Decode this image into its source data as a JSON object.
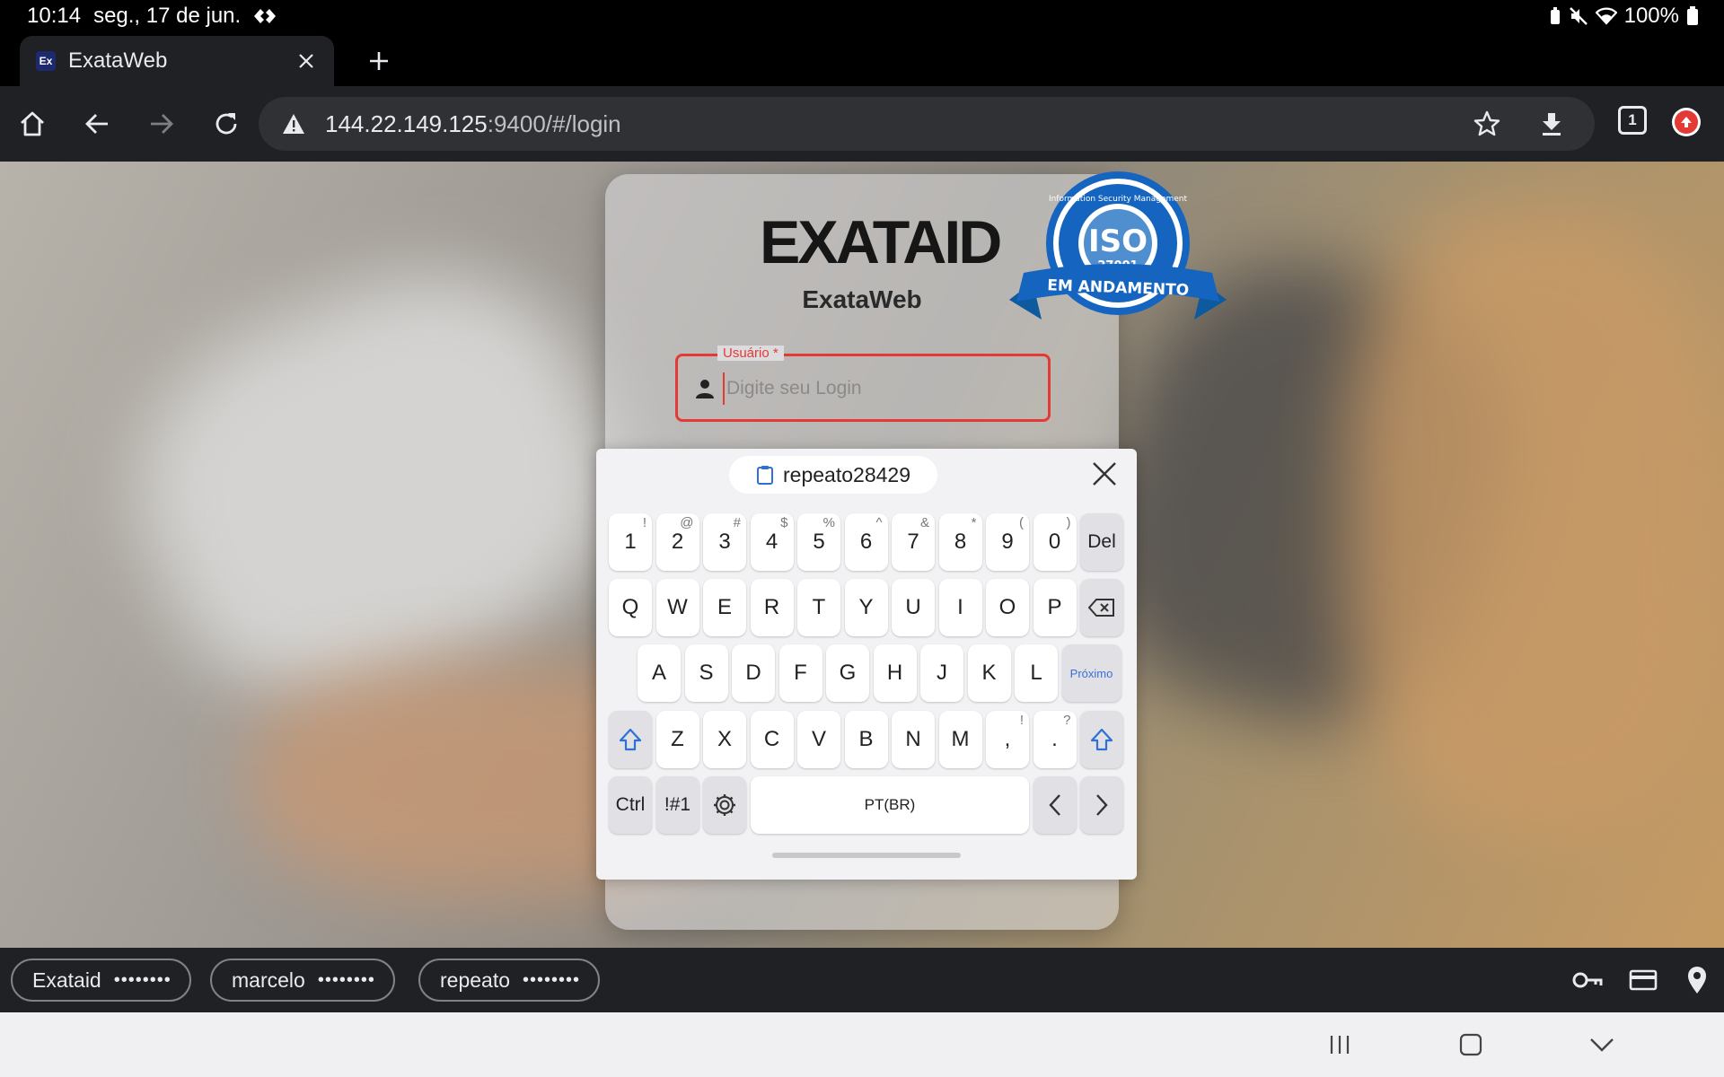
{
  "status": {
    "time": "10:14",
    "date": "seg., 17 de jun.",
    "battery": "100%"
  },
  "tab": {
    "favicon": "Ex",
    "title": "ExataWeb"
  },
  "omnibox": {
    "host": "144.22.149.125",
    "path": ":9400/#/login"
  },
  "toolbar": {
    "tab_count": "1"
  },
  "login": {
    "logo": "EXATAID",
    "app_name": "ExataWeb",
    "badge_top": "Information Security Management",
    "badge_iso": "ISO",
    "badge_num": "27001",
    "badge_ribbon": "EM ANDAMENTO",
    "user_label": "Usuário *",
    "user_placeholder": "Digite seu Login"
  },
  "keyboard": {
    "clipboard_suggestion": "repeato28429",
    "row1": [
      {
        "k": "1",
        "a": "!"
      },
      {
        "k": "2",
        "a": "@"
      },
      {
        "k": "3",
        "a": "#"
      },
      {
        "k": "4",
        "a": "$"
      },
      {
        "k": "5",
        "a": "%"
      },
      {
        "k": "6",
        "a": "^"
      },
      {
        "k": "7",
        "a": "&"
      },
      {
        "k": "8",
        "a": "*"
      },
      {
        "k": "9",
        "a": "("
      },
      {
        "k": "0",
        "a": ")"
      }
    ],
    "del_label": "Del",
    "row2": [
      "Q",
      "W",
      "E",
      "R",
      "T",
      "Y",
      "U",
      "I",
      "O",
      "P"
    ],
    "row3": [
      "A",
      "S",
      "D",
      "F",
      "G",
      "H",
      "J",
      "K",
      "L"
    ],
    "next_label": "Próximo",
    "row4": [
      {
        "k": "Z",
        "a": ""
      },
      {
        "k": "X",
        "a": ""
      },
      {
        "k": "C",
        "a": ""
      },
      {
        "k": "V",
        "a": ""
      },
      {
        "k": "B",
        "a": ""
      },
      {
        "k": "N",
        "a": ""
      },
      {
        "k": "M",
        "a": ""
      },
      {
        "k": ",",
        "a": "!"
      },
      {
        "k": ".",
        "a": "?"
      }
    ],
    "ctrl_label": "Ctrl",
    "symbols_label": "!#1",
    "space_label": "PT(BR)"
  },
  "autofill": {
    "chips": [
      {
        "user": "Exataid",
        "mask": "••••••••"
      },
      {
        "user": "marcelo",
        "mask": "••••••••"
      },
      {
        "user": "repeato",
        "mask": "••••••••"
      }
    ]
  },
  "colors": {
    "error": "#e53935",
    "chrome_dark": "#202124",
    "omnibox": "#303134",
    "keyboard_accent": "#3a6fd8"
  },
  "icons": [
    "home-icon",
    "back-icon",
    "forward-icon",
    "reload-icon",
    "warning-icon",
    "star-icon",
    "download-icon",
    "person-icon",
    "clipboard-icon",
    "close-icon",
    "backspace-icon",
    "shift-icon",
    "gear-icon",
    "key-icon",
    "card-icon",
    "location-icon"
  ]
}
